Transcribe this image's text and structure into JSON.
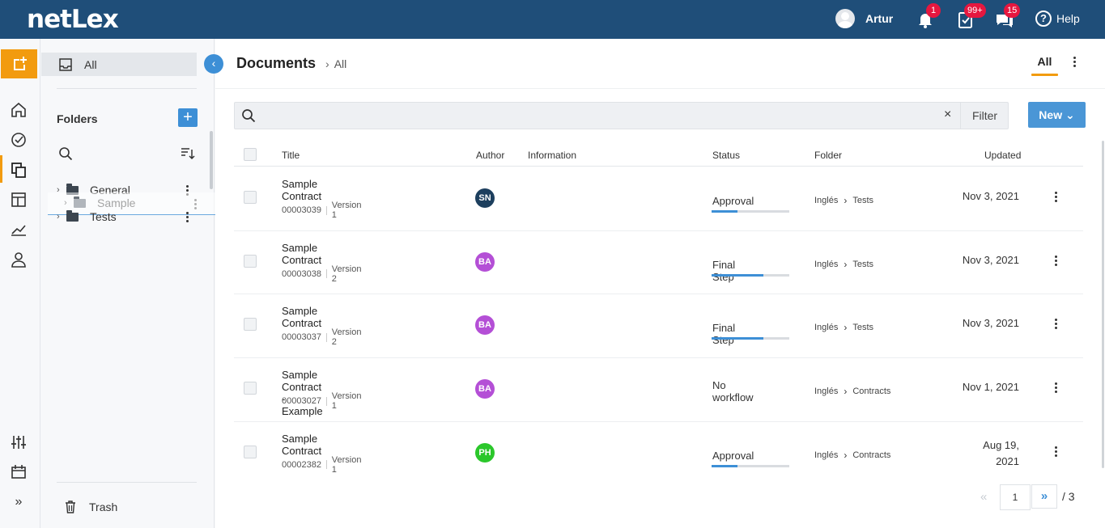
{
  "app": {
    "logo": "netLex"
  },
  "topbar": {
    "user_name": "Artur",
    "notifications_badge": "1",
    "tasks_badge": "99+",
    "messages_badge": "15",
    "help_label": "Help",
    "help_glyph": "?"
  },
  "folder_pane": {
    "all_label": "All",
    "folders_title": "Folders",
    "add_glyph": "+",
    "folders": [
      {
        "name": "General"
      },
      {
        "name": "Tests"
      }
    ],
    "dragging_folder": "Sample",
    "trash_label": "Trash",
    "collapse_glyph": "‹"
  },
  "main": {
    "title": "Documents",
    "breadcrumb_sep": "›",
    "breadcrumb_current": "All",
    "tab_all": "All",
    "search": {
      "value": "",
      "placeholder": "",
      "clear_glyph": "×"
    },
    "filter_label": "Filter",
    "new_label": "New ⌄",
    "columns": {
      "title": "Title",
      "author": "Author",
      "information": "Information",
      "status": "Status",
      "folder": "Folder",
      "updated": "Updated"
    },
    "rows": [
      {
        "title": "Sample Contract",
        "number": "00003039",
        "version": "Version 1",
        "author_initials": "SN",
        "author_color": "#1d3f5e",
        "status": "Approval",
        "progress": 0.33,
        "folder_lang": "Inglés",
        "folder_name": "Tests",
        "updated": "Nov 3, 2021"
      },
      {
        "title": "Sample Contract",
        "number": "00003038",
        "version": "Version 2",
        "author_initials": "BA",
        "author_color": "#b44fd6",
        "status": "Final Step",
        "progress": 0.67,
        "folder_lang": "Inglés",
        "folder_name": "Tests",
        "updated": "Nov 3, 2021"
      },
      {
        "title": "Sample Contract",
        "number": "00003037",
        "version": "Version 2",
        "author_initials": "BA",
        "author_color": "#b44fd6",
        "status": "Final Step",
        "progress": 0.67,
        "folder_lang": "Inglés",
        "folder_name": "Tests",
        "updated": "Nov 3, 2021"
      },
      {
        "title": "Sample Contract - Example",
        "number": "00003027",
        "version": "Version 1",
        "author_initials": "BA",
        "author_color": "#b44fd6",
        "status": "No workflow",
        "progress": null,
        "folder_lang": "Inglés",
        "folder_name": "Contracts",
        "updated": "Nov 1, 2021"
      },
      {
        "title": "Sample Contract",
        "number": "00002382",
        "version": "Version 1",
        "author_initials": "PH",
        "author_color": "#2bc72b",
        "status": "Approval",
        "progress": 0.33,
        "folder_lang": "Inglés",
        "folder_name": "Contracts",
        "updated": "Aug 19,\n2021"
      }
    ],
    "pagination": {
      "prev_glyph": "«",
      "current_page": "1",
      "next_glyph": "»",
      "total": "/ 3"
    }
  },
  "colors": {
    "topbar": "#1f4e79",
    "accent_orange": "#f29b0f",
    "accent_blue": "#3d8fd6",
    "badge_red": "#e5173f"
  }
}
